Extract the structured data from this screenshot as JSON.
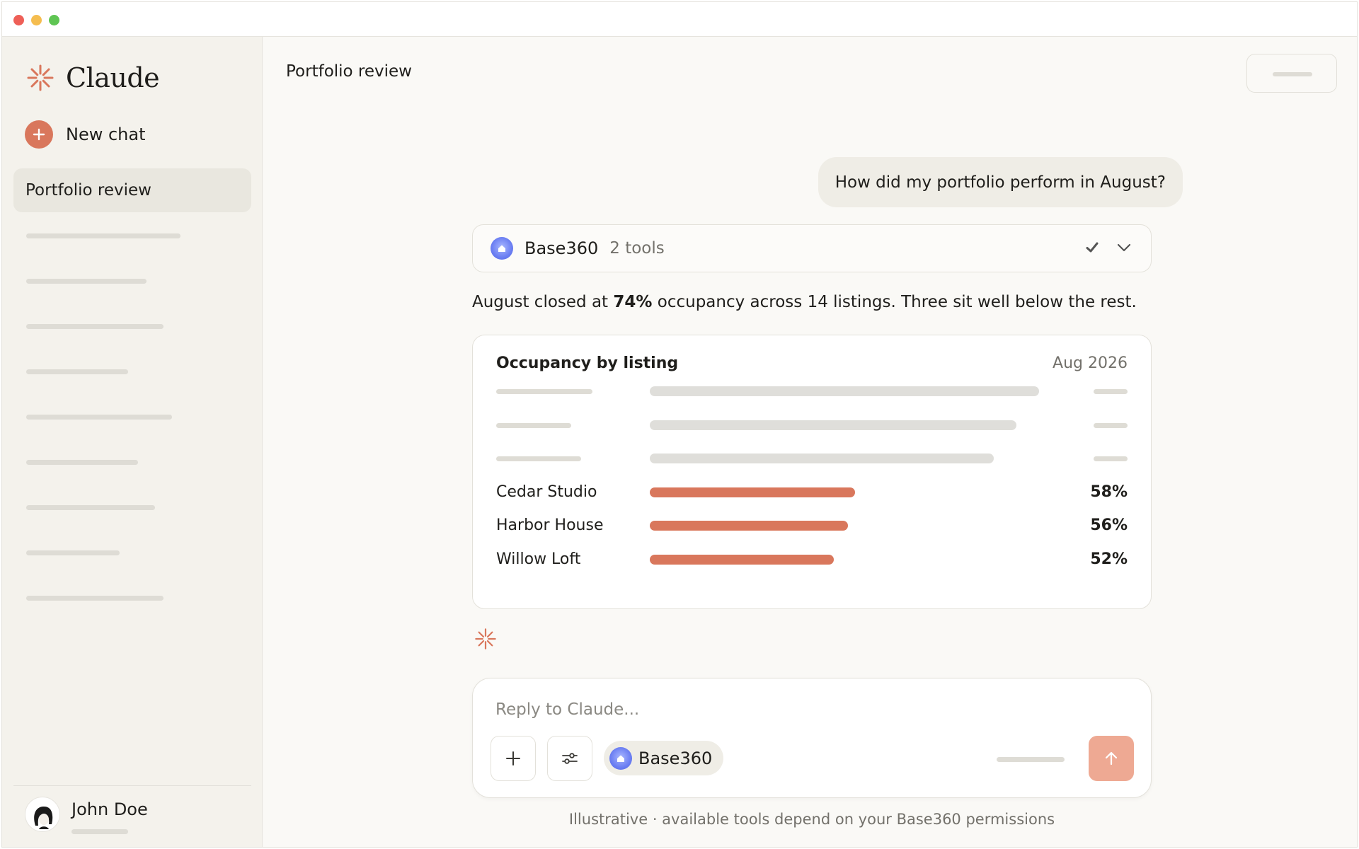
{
  "app": {
    "name": "Claude"
  },
  "sidebar": {
    "new_chat_label": "New chat",
    "active_conversation": "Portfolio review",
    "user": {
      "name": "John Doe"
    }
  },
  "header": {
    "title": "Portfolio review"
  },
  "conversation": {
    "user_message": "How did my portfolio perform in August?",
    "tool_block": {
      "name": "Base360",
      "count": "2 tools",
      "status": "done"
    },
    "summary": {
      "prefix": "August closed at ",
      "highlight": "74%",
      "suffix": " occupancy across 14 listings. Three sit well below the rest."
    }
  },
  "chart_data": {
    "type": "bar",
    "orientation": "horizontal",
    "title": "Occupancy by listing",
    "subtitle": "Aug 2026",
    "categories": [
      "Cedar Studio",
      "Harbor House",
      "Willow Loft"
    ],
    "values": [
      58,
      56,
      52
    ],
    "value_labels": [
      "58%",
      "56%",
      "52%"
    ],
    "xlim": [
      0,
      100
    ],
    "bar_color": "#d9775c",
    "placeholder_rows": 3,
    "placeholder_bar_color": "#dfdeda"
  },
  "composer": {
    "placeholder": "Reply to Claude...",
    "connector_label": "Base360"
  },
  "footer": {
    "note": "Illustrative · available tools depend on your Base360 permissions"
  },
  "colors": {
    "accent": "#d9775c",
    "send_button": "#eea993",
    "base360": "#6b7ef2",
    "background": "#faf9f6",
    "sidebar": "#f4f2ec"
  },
  "icons": {
    "brand": "claude-spark-icon",
    "new_chat": "plus-icon",
    "tool": "base360-icon",
    "tool_status": "check-icon",
    "expand": "chevron-down-icon",
    "attach": "plus-icon",
    "settings": "sliders-icon",
    "send": "arrow-up-icon"
  }
}
